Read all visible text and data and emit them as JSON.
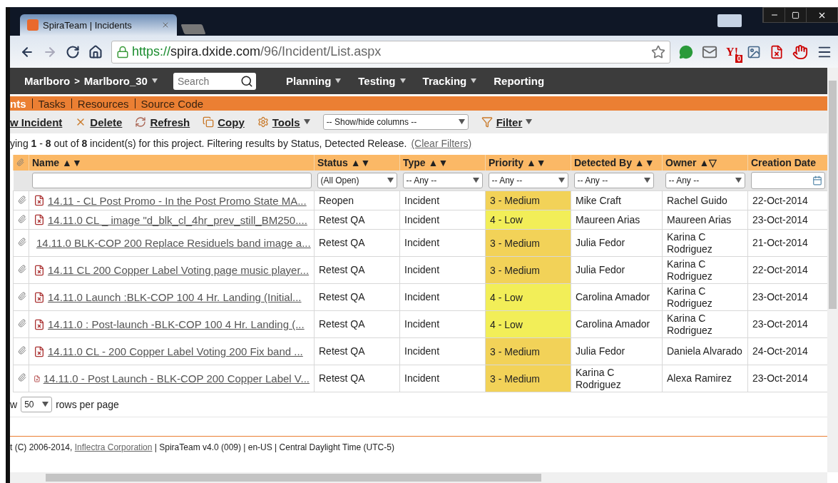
{
  "browser": {
    "tab_title": "SpiraTeam | Incidents",
    "url_scheme": "https://",
    "url_host": "spira.dxide.com",
    "url_path": "/96/Incident/List.aspx",
    "extension_label": "Y!",
    "badge": "0"
  },
  "nav": {
    "project": "Marlboro",
    "separator": ">",
    "subproject": "Marlboro_30",
    "search_placeholder": "Search",
    "menus": [
      {
        "label": "Planning",
        "dropdown": true
      },
      {
        "label": "Testing",
        "dropdown": true
      },
      {
        "label": "Tracking",
        "dropdown": true
      },
      {
        "label": "Reporting",
        "dropdown": false
      }
    ]
  },
  "subnav": [
    {
      "label": "nts",
      "selected": true
    },
    {
      "label": "Tasks",
      "selected": false
    },
    {
      "label": "Resources",
      "selected": false
    },
    {
      "label": "Source Code",
      "selected": false
    }
  ],
  "actions": [
    {
      "label": "w Incident",
      "kind": "plain",
      "dropdown": false
    },
    {
      "label": "Delete",
      "kind": "delete",
      "dropdown": false
    },
    {
      "label": "Refresh",
      "kind": "refresh",
      "dropdown": false
    },
    {
      "label": "Copy",
      "kind": "copy",
      "dropdown": false
    },
    {
      "label": "Tools",
      "kind": "tools",
      "dropdown": true
    }
  ],
  "columns_select": "-- Show/hide columns --",
  "filter_action": {
    "label": "Filter",
    "dropdown": true
  },
  "info": {
    "text": "ying **1** - **8** out of **8** incident(s) for this project. Filtering results by Status, Detected Release.",
    "link": "(Clear Filters)"
  },
  "table": {
    "columns": [
      {
        "label": "Name",
        "sort": "▲▼"
      },
      {
        "label": "Status",
        "sort": "▲▼"
      },
      {
        "label": "Type",
        "sort": "▲▼"
      },
      {
        "label": "Priority",
        "sort": "▲▼"
      },
      {
        "label": "Detected By",
        "sort": "▲▼"
      },
      {
        "label": "Owner",
        "sort": "▲▽"
      },
      {
        "label": "Creation Date"
      }
    ],
    "filters": [
      {
        "kind": "text"
      },
      {
        "kind": "select",
        "value": "(All Open)"
      },
      {
        "kind": "select",
        "value": "-- Any --"
      },
      {
        "kind": "select",
        "value": "-- Any --"
      },
      {
        "kind": "select",
        "value": "-- Any --"
      },
      {
        "kind": "select",
        "value": "-- Any --"
      },
      {
        "kind": "date"
      }
    ],
    "rows": [
      {
        "name": "14.11 - CL Post Promo - In the Post Promo State MA...",
        "status": "Reopen",
        "type": "Incident",
        "priority": "3 - Medium",
        "color": "#f2d258",
        "detected_by": "Mike Craft",
        "owner": "Rachel Guido",
        "created": "22-Oct-2014"
      },
      {
        "name": "14.11.0 CL _ image \"d_blk_cl_4hr_prev_still_BM250....",
        "status": "Retest QA",
        "type": "Incident",
        "priority": "4 - Low",
        "color": "#f2ee58",
        "detected_by": "Maureen Arias",
        "owner": "Maureen Arias",
        "created": "23-Oct-2014"
      },
      {
        "name": "14.11.0 BLK-COP 200 Replace Residuels band image a...",
        "status": "Retest QA",
        "type": "Incident",
        "priority": "3 - Medium",
        "color": "#f2d258",
        "detected_by": "Julia Fedor",
        "owner": "Karina C Rodriguez",
        "created": "21-Oct-2014"
      },
      {
        "name": "14.11 CL 200 Copper Label Voting page music player...",
        "status": "Retest QA",
        "type": "Incident",
        "priority": "3 - Medium",
        "color": "#f2d258",
        "detected_by": "Julia Fedor",
        "owner": "Karina C Rodriguez",
        "created": "22-Oct-2014"
      },
      {
        "name": "14.11.0 Launch :BLK-COP 100 4 Hr. Landing (Initial...",
        "status": "Retest QA",
        "type": "Incident",
        "priority": "4 - Low",
        "color": "#f2ee58",
        "detected_by": "Carolina Amador",
        "owner": "Karina C Rodriguez",
        "created": "23-Oct-2014"
      },
      {
        "name": "14.11.0 : Post-launch -BLK-COP 100 4 Hr. Landing (...",
        "status": "Retest QA",
        "type": "Incident",
        "priority": "4 - Low",
        "color": "#f2ee58",
        "detected_by": "Carolina Amador",
        "owner": "Karina C Rodriguez",
        "created": "23-Oct-2014"
      },
      {
        "name": "14.11.0 CL - 200 Copper Label Voting 200 Fix band ...",
        "status": "Retest QA",
        "type": "Incident",
        "priority": "3 - Medium",
        "color": "#f2d258",
        "detected_by": "Julia Fedor",
        "owner": "Daniela Alvarado",
        "created": "24-Oct-2014"
      },
      {
        "name": "14.11.0 - Post Launch - BLK-COP 200 Copper Label V...",
        "status": "Retest QA",
        "type": "Incident",
        "priority": "3 - Medium",
        "color": "#f2d258",
        "detected_by": "Karina C Rodriguez",
        "owner": "Alexa Ramirez",
        "created": "23-Oct-2014"
      }
    ]
  },
  "pager": {
    "prefix": "w",
    "size": "50",
    "suffix": "rows per page"
  },
  "footer": {
    "prefix": "t (C) 2006-2014,",
    "link": "Inflectra Corporation",
    "rest": "| SpiraTeam v4.0 (009) | en-US | Central Daylight Time (UTC-5)"
  }
}
